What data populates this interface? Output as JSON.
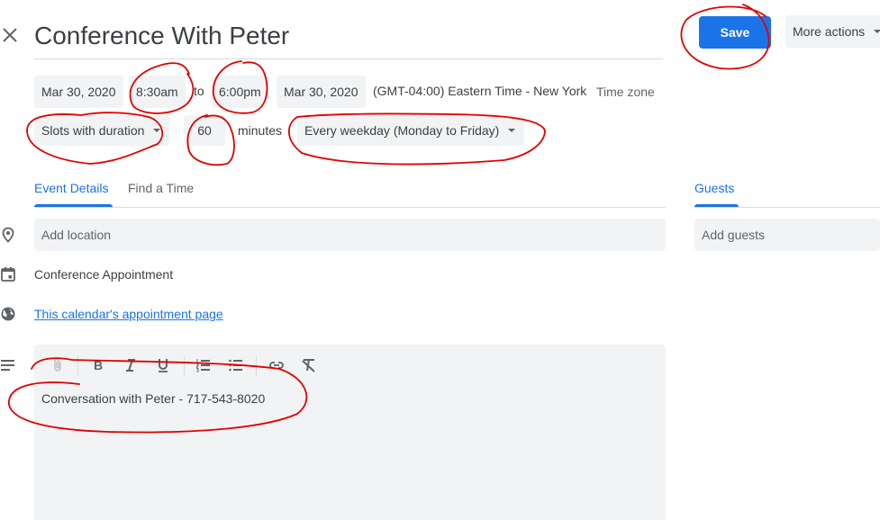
{
  "header": {
    "close_icon": "close-icon",
    "title": "Conference With Peter",
    "save_label": "Save",
    "more_actions_label": "More actions"
  },
  "datetime": {
    "start_date": "Mar 30, 2020",
    "start_time": "8:30am",
    "to_label": "to",
    "end_time": "6:00pm",
    "end_date": "Mar 30, 2020",
    "timezone_value": "(GMT-04:00) Eastern Time - New York",
    "timezone_button": "Time zone"
  },
  "slots": {
    "mode": "Slots with duration",
    "duration": "60",
    "unit_label": "minutes",
    "recurrence": "Every weekday (Monday to Friday)"
  },
  "tabs": [
    {
      "label": "Event Details",
      "active": true
    },
    {
      "label": "Find a Time",
      "active": false
    }
  ],
  "guests": {
    "tab_label": "Guests",
    "placeholder": "Add guests"
  },
  "details": {
    "location_placeholder": "Add location",
    "calendar_name": "Conference Appointment",
    "appointment_link": "This calendar's appointment page"
  },
  "description": {
    "toolbar": [
      "attachment-icon",
      "bold-icon",
      "italic-icon",
      "underline-icon",
      "numbered-list-icon",
      "bulleted-list-icon",
      "link-icon",
      "remove-formatting-icon"
    ],
    "text": "Conversation with Peter - 717-543-8020"
  },
  "colors": {
    "accent": "#1a73e8",
    "chip_bg": "#f1f3f4",
    "text": "#3c4043",
    "annotation": "#e00000"
  }
}
